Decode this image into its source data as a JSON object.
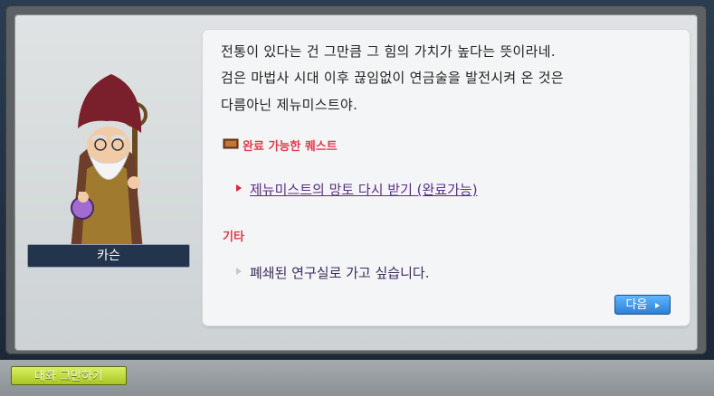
{
  "npc": {
    "name": "카슨"
  },
  "dialog": {
    "lines": [
      "전통이 있다는 건 그만큼 그 힘의 가치가 높다는 뜻이라네.",
      "검은 마법사 시대 이후 끊임없이 연금술을 발전시켜 온 것은",
      "다름아닌 제뉴미스트야."
    ],
    "quest_section_title": "완료 가능한 퀘스트",
    "quest_option": "제뉴미스트의 망토 다시 받기 (완료가능)",
    "other_section_title": "기타",
    "other_option": "폐쇄된 연구실로 가고 싶습니다.",
    "next_button_label": "다음"
  },
  "footer": {
    "end_chat_button_label": "대화 그만하기"
  },
  "icons": {
    "quest_section_icon": "book-icon",
    "quest_option_icon": "arrow-right-icon",
    "other_option_icon": "arrow-right-icon",
    "next_button_icon": "arrow-right-icon"
  },
  "colors": {
    "section_title": "#e23b4c",
    "quest_option_text": "#5b2f84",
    "next_button": "#3d90e4",
    "end_chat_button": "#c0dc3a",
    "name_plate": "#23344d"
  }
}
